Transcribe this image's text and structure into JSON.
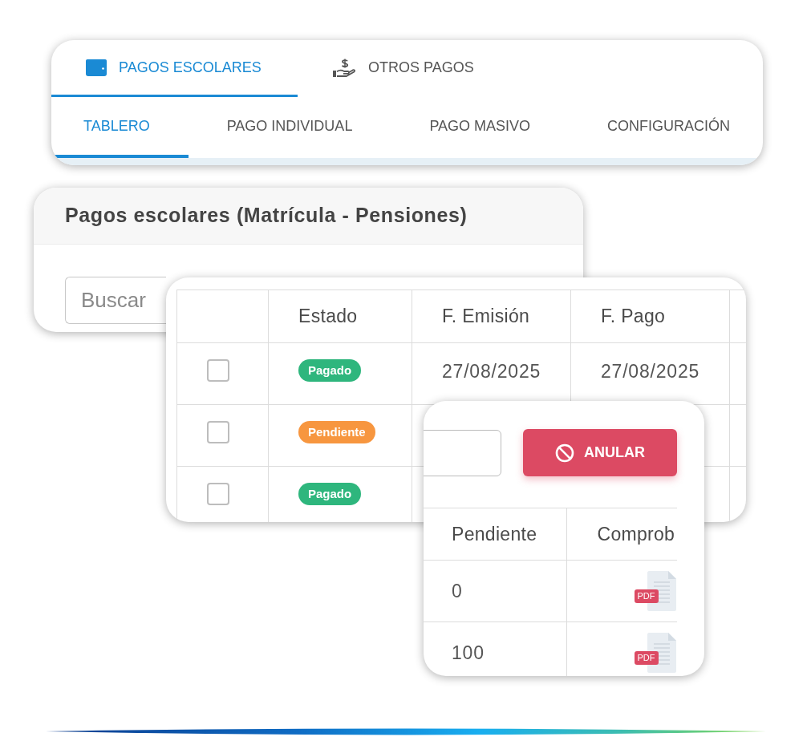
{
  "module_tabs": [
    {
      "label": "PAGOS ESCOLARES",
      "selected": true
    },
    {
      "label": "OTROS PAGOS",
      "selected": false
    }
  ],
  "section_tabs": [
    {
      "label": "TABLERO",
      "selected": true
    },
    {
      "label": "PAGO INDIVIDUAL",
      "selected": false
    },
    {
      "label": "PAGO MASIVO",
      "selected": false
    },
    {
      "label": "CONFIGURACIÓN",
      "selected": false
    }
  ],
  "payments_panel": {
    "title": "Pagos escolares (Matrícula - Pensiones)",
    "search": {
      "placeholder": "Buscar"
    }
  },
  "payments_table": {
    "columns": [
      "Estado",
      "F. Emisión",
      "F. Pago"
    ],
    "rows": [
      {
        "checked": false,
        "status": {
          "label": "Pagado",
          "color": "#2eb67d"
        },
        "cells": [
          "27/08/2025",
          "27/08/2025"
        ]
      },
      {
        "checked": false,
        "status": {
          "label": "Pendiente",
          "color": "#f7963f"
        }
      },
      {
        "checked": false,
        "status": {
          "label": "Pagado",
          "color": "#2eb67d"
        }
      }
    ]
  },
  "actions_panel": {
    "void_button": "ANULAR",
    "columns": [
      "Pendiente",
      "Comprob"
    ],
    "rows": [
      {
        "cells": [
          "0"
        ],
        "receipt_tag": "PDF"
      },
      {
        "cells": [
          "100"
        ],
        "receipt_tag": "PDF"
      }
    ]
  }
}
